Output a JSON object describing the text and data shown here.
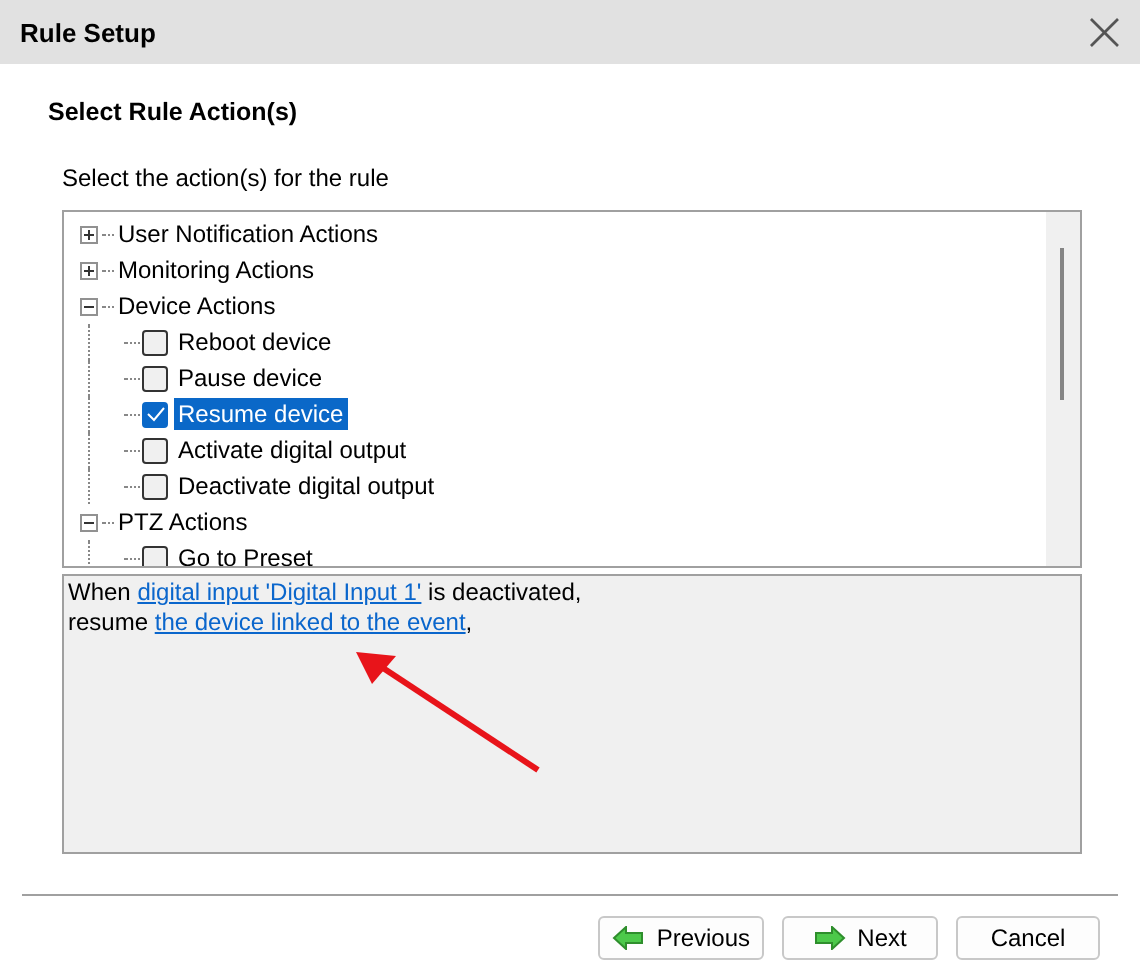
{
  "window": {
    "title": "Rule Setup",
    "close": "×"
  },
  "heading": "Select Rule Action(s)",
  "instruction": "Select the action(s) for the rule",
  "tree": [
    {
      "label": "User Notification Actions",
      "expanded": false
    },
    {
      "label": "Monitoring Actions",
      "expanded": false
    },
    {
      "label": "Device Actions",
      "expanded": true,
      "children": [
        {
          "label": "Reboot device",
          "checked": false,
          "selected": false
        },
        {
          "label": "Pause device",
          "checked": false,
          "selected": false
        },
        {
          "label": "Resume device",
          "checked": true,
          "selected": true
        },
        {
          "label": "Activate digital output",
          "checked": false,
          "selected": false
        },
        {
          "label": "Deactivate digital output",
          "checked": false,
          "selected": false
        }
      ]
    },
    {
      "label": "PTZ Actions",
      "expanded": true,
      "children": [
        {
          "label": "Go to Preset",
          "checked": false,
          "selected": false
        }
      ]
    }
  ],
  "description": [
    [
      {
        "text": "When ",
        "link": false
      },
      {
        "text": "digital input 'Digital Input 1'",
        "link": true
      },
      {
        "text": " is deactivated,",
        "link": false
      }
    ],
    [
      {
        "text": "resume ",
        "link": false
      },
      {
        "text": "the device linked to the event",
        "link": true
      },
      {
        "text": ",",
        "link": false
      }
    ]
  ],
  "buttons": [
    {
      "label": "Previous"
    },
    {
      "label": "Next"
    },
    {
      "label": "Cancel"
    }
  ]
}
